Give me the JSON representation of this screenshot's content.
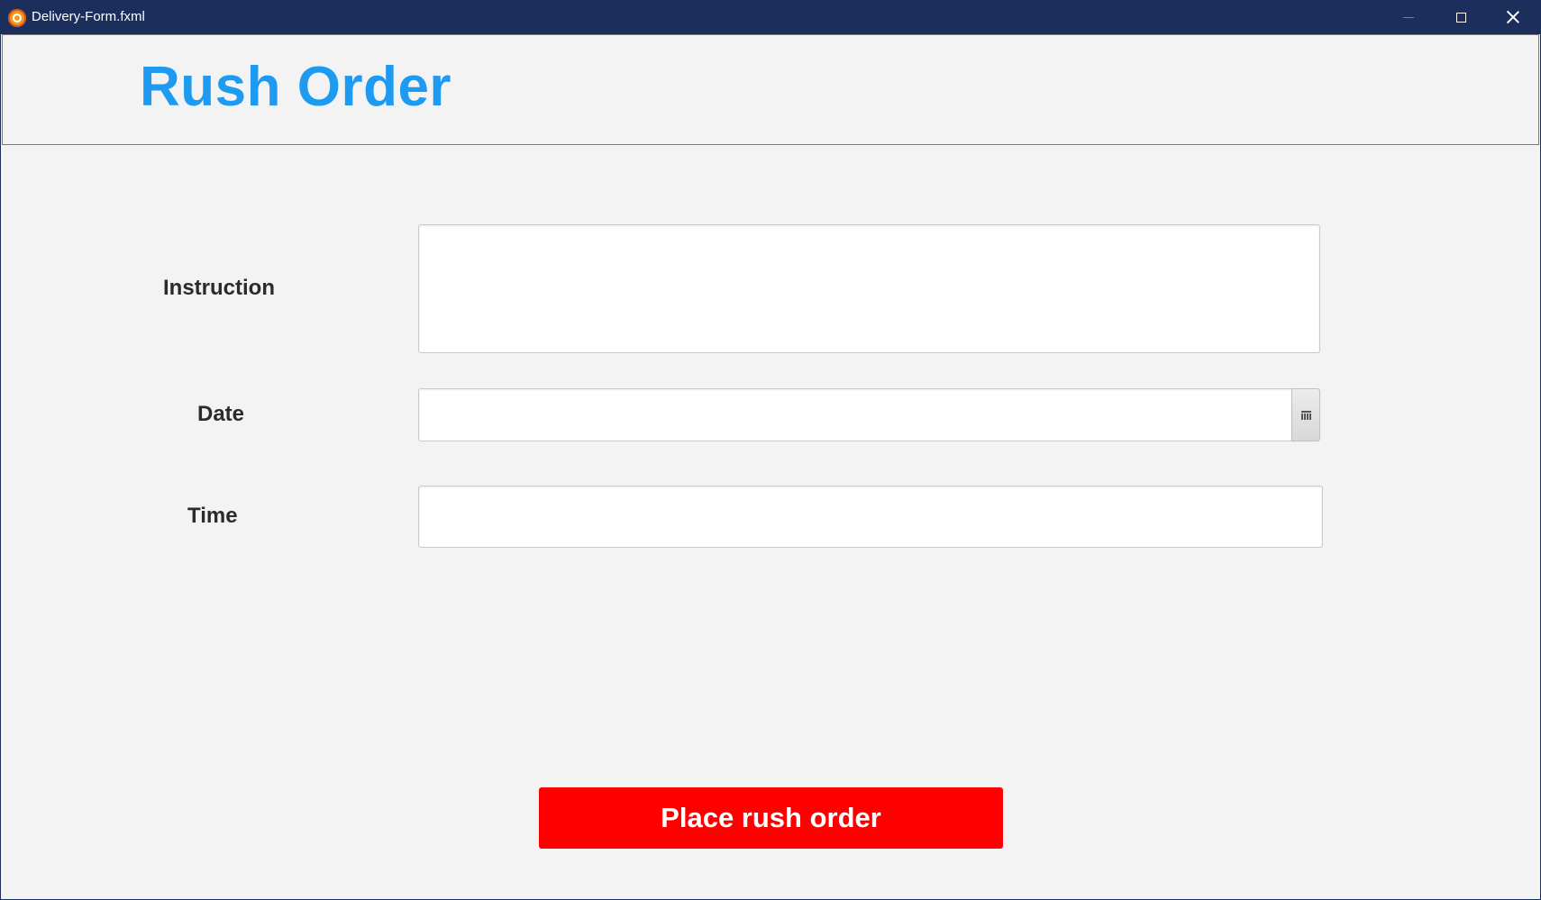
{
  "window": {
    "title": "Delivery-Form.fxml",
    "app_icon": "java-fx-icon",
    "controls": [
      "minimize-icon",
      "maximize-icon",
      "close-icon"
    ],
    "titlebar_color": "#1b2e5c"
  },
  "header": {
    "title": "Rush Order",
    "title_color": "#1e9bf0"
  },
  "form": {
    "instruction": {
      "label": "Instruction",
      "value": "",
      "placeholder": ""
    },
    "date": {
      "label": "Date",
      "value": "",
      "placeholder": "",
      "picker_icon": "calendar-icon"
    },
    "time": {
      "label": "Time",
      "value": "",
      "placeholder": ""
    }
  },
  "actions": {
    "submit_label": "Place rush order",
    "submit_color": "#ff0000"
  }
}
